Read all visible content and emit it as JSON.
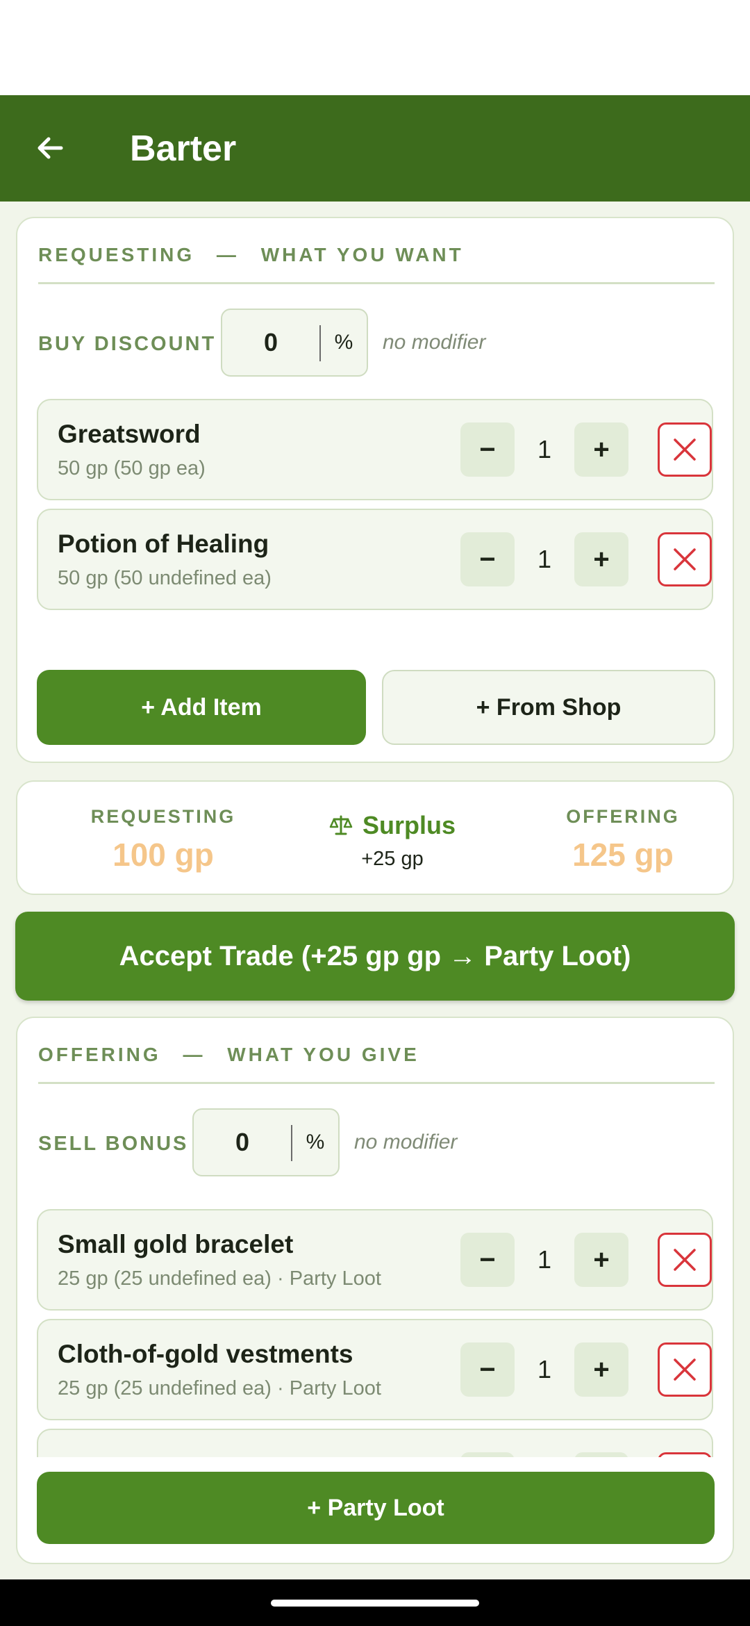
{
  "app_bar": {
    "title": "Barter",
    "back_icon": "arrow-left-icon"
  },
  "requesting": {
    "header": "REQUESTING",
    "dash": "—",
    "subheader": "WHAT YOU WANT",
    "modifier": {
      "label": "BUY DISCOUNT",
      "value": "0",
      "unit": "%",
      "note": "no modifier"
    },
    "items": [
      {
        "name": "Greatsword",
        "sub": "50 gp  (50 gp ea)",
        "qty": "1",
        "minus": "−",
        "plus": "+"
      },
      {
        "name": "Potion of Healing",
        "sub": "50 gp  (50 undefined ea)",
        "qty": "1",
        "minus": "−",
        "plus": "+"
      }
    ],
    "add_item_label": "+ Add Item",
    "from_shop_label": "+ From Shop"
  },
  "summary": {
    "requesting_label": "REQUESTING",
    "requesting_value": "100 gp",
    "status_icon": "scale-icon",
    "status_label": "Surplus",
    "status_value": "+25 gp",
    "offering_label": "OFFERING",
    "offering_value": "125 gp"
  },
  "accept_button": "Accept Trade  (+25 gp gp → Party Loot)",
  "offering": {
    "header": "OFFERING",
    "dash": "—",
    "subheader": "WHAT YOU GIVE",
    "modifier": {
      "label": "SELL BONUS",
      "value": "0",
      "unit": "%",
      "note": "no modifier"
    },
    "items": [
      {
        "name": "Small gold bracelet",
        "sub": "25 gp  (25 undefined ea)   · Party Loot",
        "qty": "1",
        "minus": "−",
        "plus": "+"
      },
      {
        "name": "Cloth-of-gold vestments",
        "sub": "25 gp  (25 undefined ea)   · Party Loot",
        "qty": "1",
        "minus": "−",
        "plus": "+"
      }
    ],
    "party_loot_label": "+ Party Loot"
  },
  "colors": {
    "app_bar": "#3d6b1c",
    "primary": "#4e8a24",
    "accent_label": "#6e8e57",
    "gold_value": "#f5c68a",
    "surplus": "#4e8a24",
    "delete": "#d9353b"
  }
}
